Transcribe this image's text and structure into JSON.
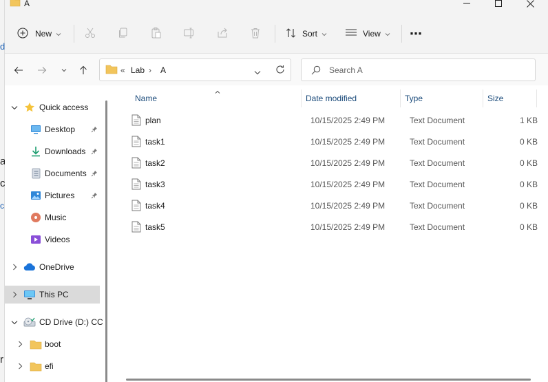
{
  "window": {
    "title": "A"
  },
  "background_text": [
    "d",
    "a",
    "c",
    "c",
    "r"
  ],
  "toolbar": {
    "new_label": "New",
    "sort_label": "Sort",
    "view_label": "View",
    "more_label": "⋯"
  },
  "address": {
    "overflow": "«",
    "crumbs": [
      "Lab",
      "A"
    ],
    "separator": "›"
  },
  "search": {
    "placeholder": "Search A"
  },
  "nav": {
    "quick_access": "Quick access",
    "items": [
      {
        "label": "Desktop",
        "icon": "desktop-icon",
        "pinned": true
      },
      {
        "label": "Downloads",
        "icon": "download-icon",
        "pinned": true
      },
      {
        "label": "Documents",
        "icon": "documents-icon",
        "pinned": true
      },
      {
        "label": "Pictures",
        "icon": "pictures-icon",
        "pinned": true
      },
      {
        "label": "Music",
        "icon": "music-icon",
        "pinned": false
      },
      {
        "label": "Videos",
        "icon": "videos-icon",
        "pinned": false
      }
    ],
    "onedrive": "OneDrive",
    "this_pc": "This PC",
    "cd_drive": "CD Drive (D:) CC",
    "cd_children": [
      "boot",
      "efi"
    ]
  },
  "columns": {
    "name": "Name",
    "date": "Date modified",
    "type": "Type",
    "size": "Size"
  },
  "files": [
    {
      "name": "plan",
      "date": "10/15/2025 2:49 PM",
      "type": "Text Document",
      "size": "1 KB"
    },
    {
      "name": "task1",
      "date": "10/15/2025 2:49 PM",
      "type": "Text Document",
      "size": "0 KB"
    },
    {
      "name": "task2",
      "date": "10/15/2025 2:49 PM",
      "type": "Text Document",
      "size": "0 KB"
    },
    {
      "name": "task3",
      "date": "10/15/2025 2:49 PM",
      "type": "Text Document",
      "size": "0 KB"
    },
    {
      "name": "task4",
      "date": "10/15/2025 2:49 PM",
      "type": "Text Document",
      "size": "0 KB"
    },
    {
      "name": "task5",
      "date": "10/15/2025 2:49 PM",
      "type": "Text Document",
      "size": "0 KB"
    }
  ],
  "colors": {
    "folder": "#f2c55c",
    "star": "#f5c33b",
    "accent": "#1a4a7a",
    "selected": "#dadada"
  }
}
